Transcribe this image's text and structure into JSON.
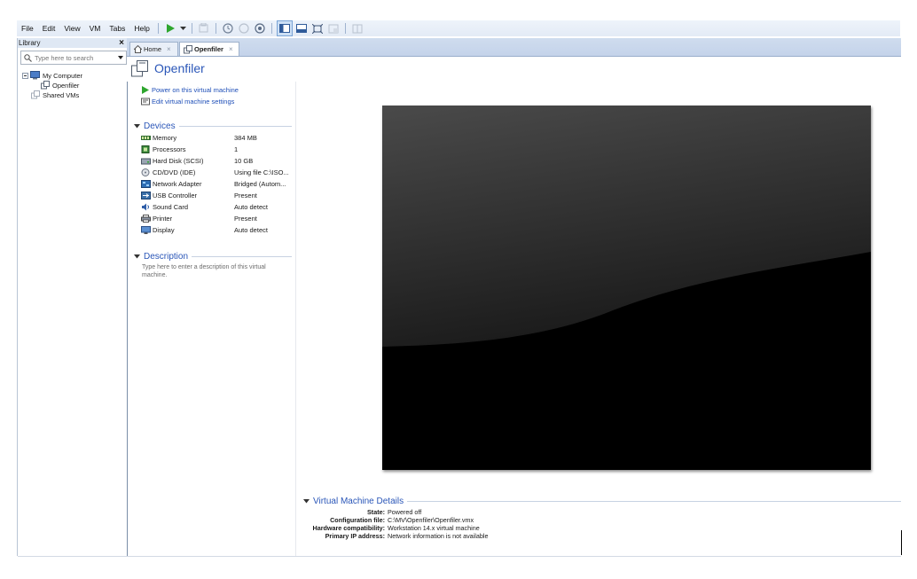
{
  "menu": {
    "items": [
      "File",
      "Edit",
      "View",
      "VM",
      "Tabs",
      "Help"
    ]
  },
  "toolbar": {
    "icons": [
      "play-icon",
      "dropdown-arrow-icon",
      "send-keys-icon",
      "snapshot-icon",
      "revert-snapshot-icon",
      "snapshot-manager-icon",
      "library-view-icon",
      "console-view-icon",
      "full-screen-icon",
      "unity-icon",
      "thumbnail-icon"
    ]
  },
  "library": {
    "title": "Library",
    "close_label": "×",
    "search_placeholder": "Type here to search",
    "tree": {
      "root": "My Computer",
      "child": "Openfiler",
      "shared": "Shared VMs"
    }
  },
  "tabs": [
    {
      "label": "Home",
      "close": "×"
    },
    {
      "label": "Openfiler",
      "close": "×"
    }
  ],
  "vm": {
    "title": "Openfiler",
    "actions": {
      "power_on": "Power on this virtual machine",
      "edit_settings": "Edit virtual machine settings"
    },
    "devices_title": "Devices",
    "devices": [
      {
        "name": "Memory",
        "value": "384 MB",
        "icon": "memory-icon"
      },
      {
        "name": "Processors",
        "value": "1",
        "icon": "processor-icon"
      },
      {
        "name": "Hard Disk (SCSI)",
        "value": "10 GB",
        "icon": "hard-disk-icon"
      },
      {
        "name": "CD/DVD (IDE)",
        "value": "Using file C:\\ISO...",
        "icon": "cd-dvd-icon"
      },
      {
        "name": "Network Adapter",
        "value": "Bridged (Autom...",
        "icon": "network-adapter-icon"
      },
      {
        "name": "USB Controller",
        "value": "Present",
        "icon": "usb-icon"
      },
      {
        "name": "Sound Card",
        "value": "Auto detect",
        "icon": "sound-icon"
      },
      {
        "name": "Printer",
        "value": "Present",
        "icon": "printer-icon"
      },
      {
        "name": "Display",
        "value": "Auto detect",
        "icon": "display-icon"
      }
    ],
    "description_title": "Description",
    "description_placeholder": "Type here to enter a description of this virtual machine.",
    "details_title": "Virtual Machine Details",
    "details": [
      {
        "label": "State:",
        "value": "Powered off"
      },
      {
        "label": "Configuration file:",
        "value": "C:\\MV\\Openfiler\\Openfiler.vmx"
      },
      {
        "label": "Hardware compatibility:",
        "value": "Workstation 14.x virtual machine"
      },
      {
        "label": "Primary IP address:",
        "value": "Network information is not available"
      }
    ]
  },
  "colors": {
    "accent_blue": "#2a56b8",
    "link_blue": "#1f4fb8",
    "play_green": "#2ea62e",
    "tab_bar": "#c9d7ec"
  }
}
